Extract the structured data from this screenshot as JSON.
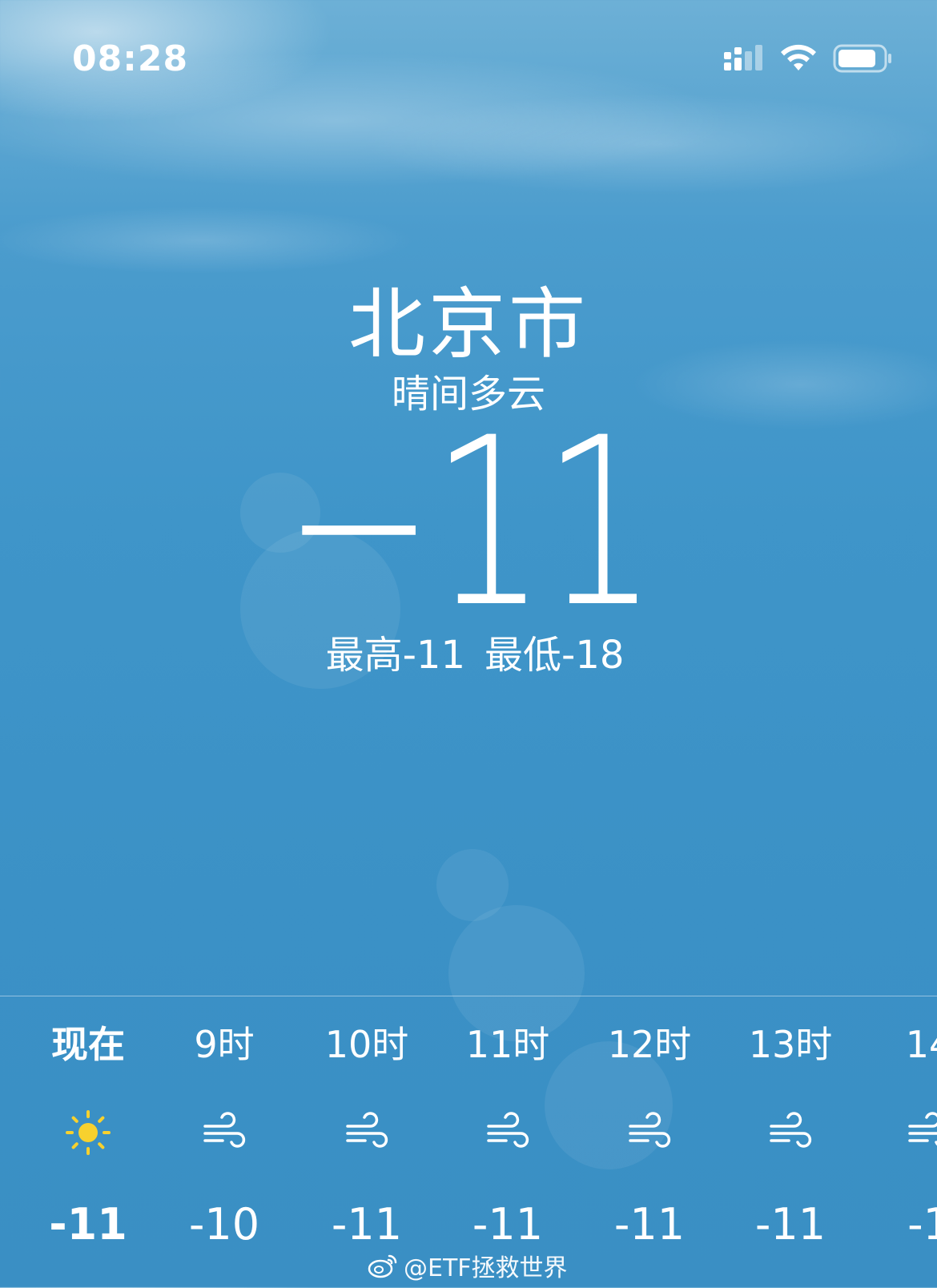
{
  "status_bar": {
    "time": "08:28",
    "icons": [
      "cellular-signal-icon",
      "wifi-icon",
      "battery-icon"
    ]
  },
  "location": {
    "city": "北京市",
    "condition": "晴间多云",
    "temperature": "−11",
    "high_label": "最高-11",
    "low_label": "最低-18"
  },
  "hourly": [
    {
      "time": "现在",
      "icon": "sun-icon",
      "temp": "-11"
    },
    {
      "time": "9时",
      "icon": "wind-icon",
      "temp": "-10"
    },
    {
      "time": "10时",
      "icon": "wind-icon",
      "temp": "-11"
    },
    {
      "time": "11时",
      "icon": "wind-icon",
      "temp": "-11"
    },
    {
      "time": "12时",
      "icon": "wind-icon",
      "temp": "-11"
    },
    {
      "time": "13时",
      "icon": "wind-icon",
      "temp": "-11"
    },
    {
      "time": "14",
      "icon": "wind-icon",
      "temp": "-1"
    }
  ],
  "watermark": "@ETF拯救世界",
  "colors": {
    "sky_top": "#6db0d6",
    "sky_bottom": "#3a8fc4",
    "sun": "#f7d12e",
    "text": "#ffffff"
  }
}
